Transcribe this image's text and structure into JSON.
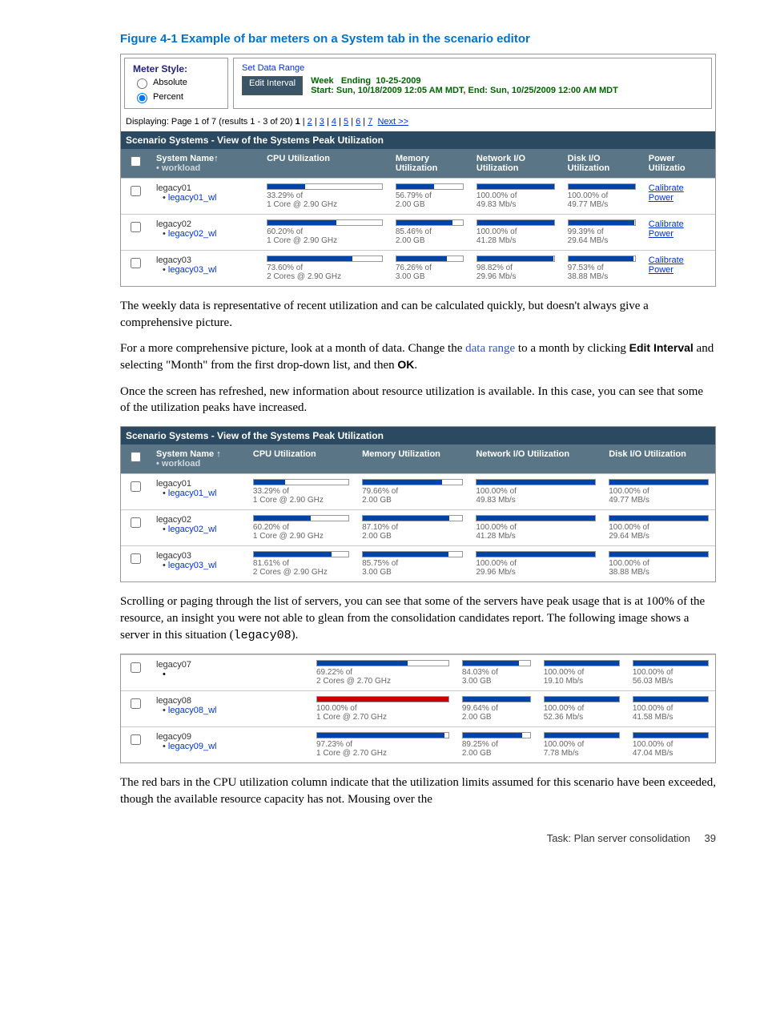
{
  "figure_title": "Figure 4-1 Example of bar meters on a System tab in the scenario editor",
  "meter_panel": {
    "title": "Meter Style:",
    "opt_absolute": "Absolute",
    "opt_percent": "Percent"
  },
  "range_panel": {
    "title": "Set Data Range",
    "edit_btn": "Edit Interval",
    "week_lbl": "Week",
    "ending_lbl": "Ending",
    "date": "10-25-2009",
    "start_line": "Start: Sun, 10/18/2009 12:05 AM MDT, End: Sun, 10/25/2009 12:00 AM MDT"
  },
  "pager": {
    "prefix": "Displaying: Page 1 of 7 (results 1 - 3 of 20) ",
    "current": "1",
    "sep": " | ",
    "p2": "2",
    "p3": "3",
    "p4": "4",
    "p5": "5",
    "p6": "6",
    "p7": "7",
    "next": "Next >>"
  },
  "table1": {
    "banner": "Scenario Systems - View of the Systems Peak Utilization",
    "headers": {
      "sys": "System Name↑",
      "workload_bullet": "workload",
      "cpu": "CPU Utilization",
      "mem": "Memory",
      "mem2": "Utilization",
      "net": "Network I/O",
      "net2": "Utilization",
      "disk": "Disk I/O",
      "disk2": "Utilization",
      "pow": "Power",
      "pow2": "Utilizatio"
    },
    "rows": [
      {
        "sys": "legacy01",
        "wl": "legacy01_wl",
        "cpu_pct": "33.29% of",
        "cpu_sub": "1 Core @ 2.90 GHz",
        "cpu_bar": 33,
        "mem_pct": "56.79% of",
        "mem_sub": "2.00  GB",
        "mem_bar": 57,
        "net_pct": "100.00% of",
        "net_sub": "49.83 Mb/s",
        "net_bar": 100,
        "disk_pct": "100.00% of",
        "disk_sub": "49.77 MB/s",
        "disk_bar": 100,
        "cal": "Calibrate",
        "pow": "Power"
      },
      {
        "sys": "legacy02",
        "wl": "legacy02_wl",
        "cpu_pct": "60.20% of",
        "cpu_sub": "1 Core @ 2.90 GHz",
        "cpu_bar": 60,
        "mem_pct": "85.46% of",
        "mem_sub": "2.00  GB",
        "mem_bar": 85,
        "net_pct": "100.00% of",
        "net_sub": "41.28 Mb/s",
        "net_bar": 100,
        "disk_pct": "99.39% of",
        "disk_sub": "29.64 MB/s",
        "disk_bar": 99,
        "cal": "Calibrate",
        "pow": "Power"
      },
      {
        "sys": "legacy03",
        "wl": "legacy03_wl",
        "cpu_pct": "73.60% of",
        "cpu_sub": "2 Cores @ 2.90 GHz",
        "cpu_bar": 74,
        "mem_pct": "76.26% of",
        "mem_sub": "3.00  GB",
        "mem_bar": 76,
        "net_pct": "98.82% of",
        "net_sub": "29.96 Mb/s",
        "net_bar": 99,
        "disk_pct": "97.53% of",
        "disk_sub": "38.88 MB/s",
        "disk_bar": 98,
        "cal": "Calibrate",
        "pow": "Power"
      }
    ]
  },
  "para1": "The weekly data is representative of recent utilization and can be calculated quickly, but doesn't always give a comprehensive picture.",
  "para2a": "For a more comprehensive picture, look at a month of data. Change the ",
  "para2link": "data range",
  "para2b": " to a month by clicking ",
  "para2bold1": "Edit Interval",
  "para2c": " and selecting \"Month\" from the first drop-down list, and then ",
  "para2bold2": "OK",
  "para2d": ".",
  "para3": "Once the screen has refreshed, new information about resource utilization is available. In this case, you can see that some of the utilization peaks have increased.",
  "table2": {
    "banner": "Scenario Systems - View of the Systems Peak Utilization",
    "headers": {
      "sys": "System Name ↑",
      "workload_bullet": "workload",
      "cpu": "CPU Utilization",
      "mem": "Memory Utilization",
      "net": "Network I/O Utilization",
      "disk": "Disk I/O Utilization"
    },
    "rows": [
      {
        "sys": "legacy01",
        "wl": "legacy01_wl",
        "cpu_pct": "33.29% of",
        "cpu_sub": "1 Core @ 2.90  GHz",
        "cpu_bar": 33,
        "mem_pct": "79.66% of",
        "mem_sub": "2.00  GB",
        "mem_bar": 80,
        "net_pct": "100.00% of",
        "net_sub": "49.83 Mb/s",
        "net_bar": 100,
        "disk_pct": "100.00% of",
        "disk_sub": "49.77 MB/s",
        "disk_bar": 100
      },
      {
        "sys": "legacy02",
        "wl": "legacy02_wl",
        "cpu_pct": "60.20% of",
        "cpu_sub": "1 Core @ 2.90  GHz",
        "cpu_bar": 60,
        "mem_pct": "87.10% of",
        "mem_sub": "2.00  GB",
        "mem_bar": 87,
        "net_pct": "100.00% of",
        "net_sub": "41.28 Mb/s",
        "net_bar": 100,
        "disk_pct": "100.00% of",
        "disk_sub": "29.64 MB/s",
        "disk_bar": 100
      },
      {
        "sys": "legacy03",
        "wl": "legacy03_wl",
        "cpu_pct": "81.61% of",
        "cpu_sub": "2 Cores @ 2.90  GHz",
        "cpu_bar": 82,
        "mem_pct": "85.75% of",
        "mem_sub": "3.00  GB",
        "mem_bar": 86,
        "net_pct": "100.00% of",
        "net_sub": "29.96 Mb/s",
        "net_bar": 100,
        "disk_pct": "100.00% of",
        "disk_sub": "38.88 MB/s",
        "disk_bar": 100
      }
    ]
  },
  "para4a": "Scrolling or paging through the list of servers, you can see that some of the servers have peak usage that is at 100% of the resource, an insight you were not able to glean from the consolidation candidates report. The following image shows a server in this situation (",
  "para4mono": "legacy08",
  "para4b": ").",
  "table3": {
    "rows": [
      {
        "sys": "legacy07",
        "wl": "",
        "cpu_pct": "69.22% of",
        "cpu_sub": "2 Cores @ 2.70 GHz",
        "cpu_bar": 69,
        "mem_pct": "84.03% of",
        "mem_sub": "3.00  GB",
        "mem_bar": 84,
        "net_pct": "100.00% of",
        "net_sub": "19.10 Mb/s",
        "net_bar": 100,
        "disk_pct": "100.00% of",
        "disk_sub": "56.03 MB/s",
        "disk_bar": 100
      },
      {
        "sys": "legacy08",
        "wl": "legacy08_wl",
        "cpu_pct": "100.00% of",
        "cpu_sub": "1 Core @ 2.70  GHz",
        "cpu_bar": 100,
        "cpu_red": true,
        "mem_pct": "99.64% of",
        "mem_sub": "2.00  GB",
        "mem_bar": 100,
        "net_pct": "100.00% of",
        "net_sub": "52.36 Mb/s",
        "net_bar": 100,
        "disk_pct": "100.00% of",
        "disk_sub": "41.58 MB/s",
        "disk_bar": 100
      },
      {
        "sys": "legacy09",
        "wl": "legacy09_wl",
        "cpu_pct": "97.23% of",
        "cpu_sub": "1 Core @ 2.70  GHz",
        "cpu_bar": 97,
        "mem_pct": "89.25% of",
        "mem_sub": "2.00  GB",
        "mem_bar": 89,
        "net_pct": "100.00% of",
        "net_sub": "7.78 Mb/s",
        "net_bar": 100,
        "disk_pct": "100.00% of",
        "disk_sub": "47.04 MB/s",
        "disk_bar": 100
      }
    ]
  },
  "para5": "The red bars in the CPU utilization column indicate that the utilization limits assumed for this scenario have been exceeded, though the available resource capacity has not. Mousing over the",
  "footer": {
    "task": "Task: Plan server consolidation",
    "page": "39"
  },
  "chart_data": [
    {
      "type": "table",
      "title": "Scenario Systems - View of the Systems Peak Utilization (Week)",
      "columns": [
        "System",
        "CPU %",
        "Memory %",
        "Network I/O %",
        "Disk I/O %"
      ],
      "rows": [
        [
          "legacy01",
          33.29,
          56.79,
          100.0,
          100.0
        ],
        [
          "legacy02",
          60.2,
          85.46,
          100.0,
          99.39
        ],
        [
          "legacy03",
          73.6,
          76.26,
          98.82,
          97.53
        ]
      ]
    },
    {
      "type": "table",
      "title": "Scenario Systems - View of the Systems Peak Utilization (Month)",
      "columns": [
        "System",
        "CPU %",
        "Memory %",
        "Network I/O %",
        "Disk I/O %"
      ],
      "rows": [
        [
          "legacy01",
          33.29,
          79.66,
          100.0,
          100.0
        ],
        [
          "legacy02",
          60.2,
          87.1,
          100.0,
          100.0
        ],
        [
          "legacy03",
          81.61,
          85.75,
          100.0,
          100.0
        ]
      ]
    },
    {
      "type": "table",
      "title": "Servers at 100% (excerpt)",
      "columns": [
        "System",
        "CPU %",
        "Memory %",
        "Network I/O %",
        "Disk I/O %"
      ],
      "rows": [
        [
          "legacy07",
          69.22,
          84.03,
          100.0,
          100.0
        ],
        [
          "legacy08",
          100.0,
          99.64,
          100.0,
          100.0
        ],
        [
          "legacy09",
          97.23,
          89.25,
          100.0,
          100.0
        ]
      ]
    }
  ]
}
